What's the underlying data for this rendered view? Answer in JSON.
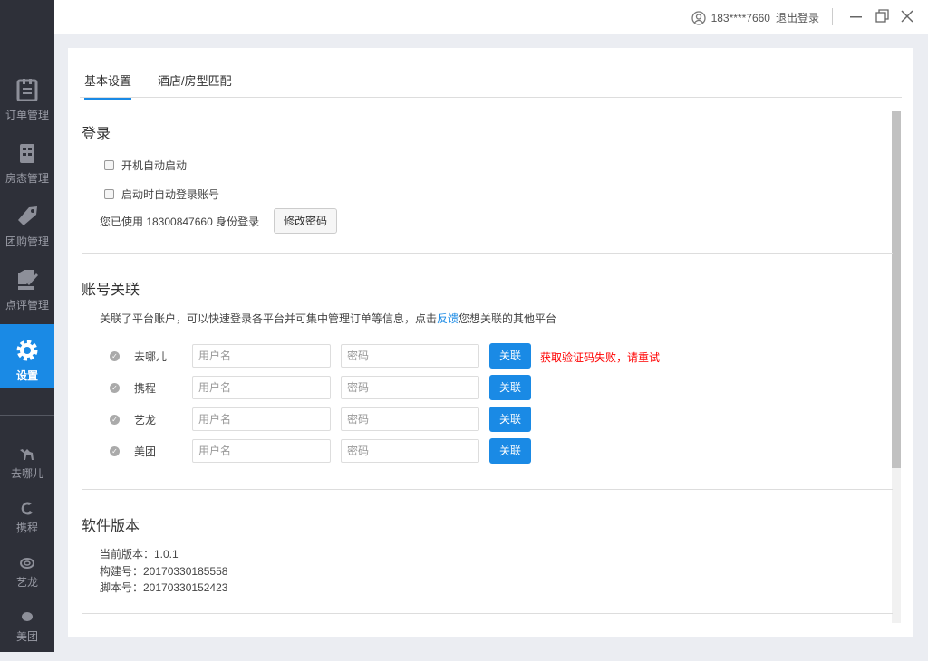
{
  "sidebar": {
    "items": [
      {
        "label": "订单管理"
      },
      {
        "label": "房态管理"
      },
      {
        "label": "团购管理"
      },
      {
        "label": "点评管理"
      },
      {
        "label": "设置"
      }
    ],
    "platforms": [
      {
        "label": "去哪儿"
      },
      {
        "label": "携程"
      },
      {
        "label": "艺龙"
      },
      {
        "label": "美团"
      }
    ]
  },
  "topbar": {
    "user": "183****7660",
    "logout": "退出登录"
  },
  "tabs": [
    {
      "label": "基本设置"
    },
    {
      "label": "酒店/房型匹配"
    }
  ],
  "login": {
    "title": "登录",
    "auto_start": "开机自动启动",
    "auto_login": "启动时自动登录账号",
    "identity": "您已使用 18300847660 身份登录",
    "change_pwd": "修改密码"
  },
  "link": {
    "title": "账号关联",
    "desc_before": "关联了平台账户，可以快速登录各平台并可集中管理订单等信息，点击",
    "desc_link": "反馈",
    "desc_after": "您想关联的其他平台",
    "username_placeholder": "用户名",
    "password_placeholder": "密码",
    "button": "关联",
    "rows": [
      {
        "name": "去哪儿",
        "error": "获取验证码失败，请重试"
      },
      {
        "name": "携程"
      },
      {
        "name": "艺龙"
      },
      {
        "name": "美团"
      }
    ]
  },
  "version": {
    "title": "软件版本",
    "current": "当前版本：1.0.1",
    "build": "构建号：20170330185558",
    "script": "脚本号：20170330152423"
  },
  "colors": {
    "accent": "#1a8ae5",
    "sidebar": "#2e3039",
    "error": "#ff0000"
  }
}
